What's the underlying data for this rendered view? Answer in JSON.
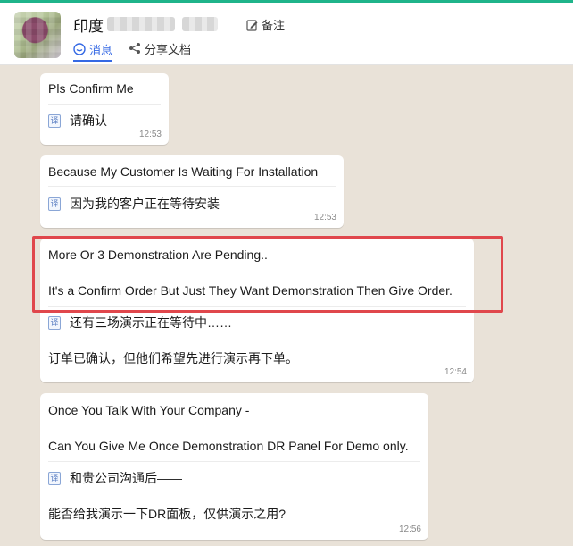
{
  "header": {
    "title": "印度",
    "note_label": "备注",
    "tabs": [
      {
        "label": "消息",
        "icon": "chat-icon",
        "active": true
      },
      {
        "label": "分享文档",
        "icon": "share-icon",
        "active": false
      }
    ]
  },
  "messages": [
    {
      "original": [
        "Pls Confirm Me"
      ],
      "translation": [
        "请确认"
      ],
      "time": "12:53"
    },
    {
      "original": [
        "Because My Customer Is Waiting For Installation"
      ],
      "translation": [
        "因为我的客户正在等待安装"
      ],
      "time": "12:53"
    },
    {
      "original": [
        "More Or 3 Demonstration  Are Pending..",
        "It's a Confirm Order But Just They Want Demonstration Then Give Order."
      ],
      "translation": [
        "还有三场演示正在等待中……",
        "订单已确认，但他们希望先进行演示再下单。"
      ],
      "time": "12:54"
    },
    {
      "original": [
        "Once You Talk With Your Company -",
        "Can You Give Me Once Demonstration DR Panel For Demo only."
      ],
      "translation": [
        "和贵公司沟通后——",
        "能否给我演示一下DR面板，仅供演示之用?"
      ],
      "time": "12:56"
    }
  ],
  "translate_icon_glyph": "译",
  "colors": {
    "accent": "#3569e4",
    "highlight": "#e0474c",
    "top_bar": "#1fb48a",
    "chat_bg": "#e9e2d8"
  }
}
